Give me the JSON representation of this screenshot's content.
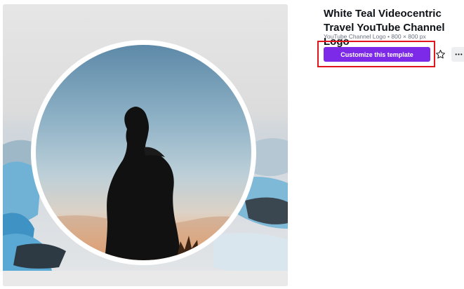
{
  "template": {
    "title": "White Teal Videocentric Travel YouTube Channel Logo",
    "meta": "YouTube Channel Logo • 800 × 800 px"
  },
  "actions": {
    "customize_label": "Customize this template",
    "favorite_icon": "star-outline-icon",
    "more_icon": "more-horizontal-icon"
  },
  "colors": {
    "accent": "#7d2ae8",
    "highlight": "#e0161f",
    "title_text": "#0e1318",
    "meta_text": "#6b7280"
  }
}
